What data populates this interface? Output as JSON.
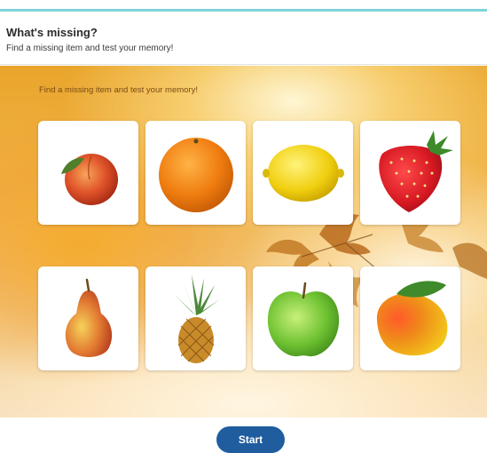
{
  "header": {
    "title": "What's missing?",
    "subtitle": "Find a missing item and test your memory!"
  },
  "stage": {
    "instruction": "Find a missing item and test your memory!"
  },
  "cards": [
    {
      "fruit": "peach"
    },
    {
      "fruit": "orange"
    },
    {
      "fruit": "lemon"
    },
    {
      "fruit": "strawberry"
    },
    {
      "fruit": "pear"
    },
    {
      "fruit": "pineapple"
    },
    {
      "fruit": "green-apple"
    },
    {
      "fruit": "mango"
    }
  ],
  "footer": {
    "start_label": "Start"
  },
  "colors": {
    "accent_line": "#7fd3d9",
    "button": "#1f5d9e"
  }
}
